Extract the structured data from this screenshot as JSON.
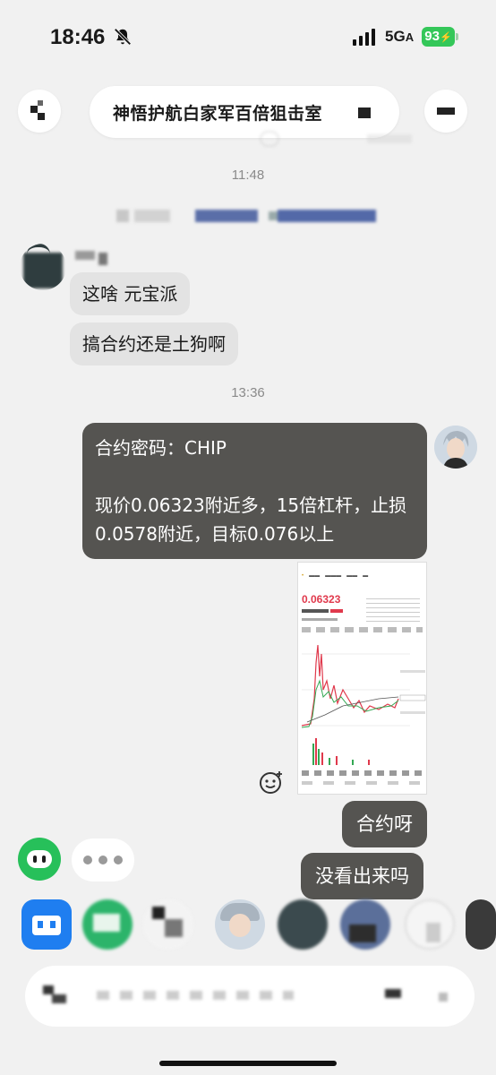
{
  "status_bar": {
    "time": "18:46",
    "network": "5G",
    "battery": "93",
    "icons": [
      "bell-muted-icon",
      "signal-icon",
      "battery-charging-icon"
    ]
  },
  "header": {
    "title": "神悟护航白家军百倍狙击室"
  },
  "messages": {
    "time1": "11:48",
    "msg1": "这啥 元宝派",
    "msg2": "搞合约还是土狗啊",
    "time2": "13:36",
    "contract_line": "合约密码：CHIP",
    "trade_line": "现价0.06323附近多，15倍杠杆，止损0.0578附近，目标0.076以上",
    "screenshot": {
      "price": "0.06323"
    },
    "reply1": "合约呀",
    "reply2": "没看出来吗"
  },
  "colors": {
    "bubble_dark": "#555451",
    "bubble_light": "#e3e3e3",
    "background": "#f1f1f1",
    "battery": "#34c759",
    "price_red": "#e0394c"
  }
}
